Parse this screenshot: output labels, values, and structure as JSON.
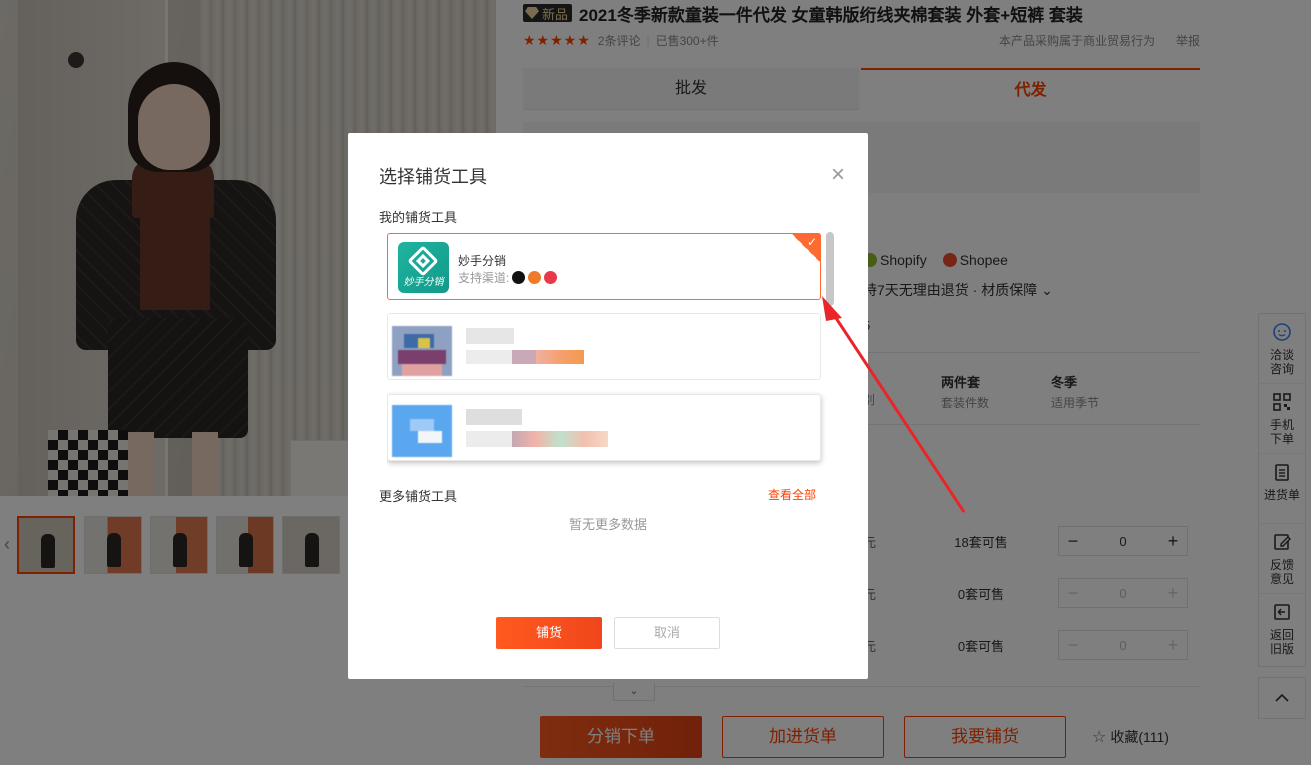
{
  "product": {
    "badge": "新品",
    "title": "2021冬季新款童装一件代发 女童韩版绗线夹棉套装 外套+短裤 套装",
    "rating_stars": "★★★★★",
    "reviews": "2条评论",
    "sold": "已售300+件",
    "notice": "本产品采购属于商业贸易行为",
    "report": "举报"
  },
  "tabs": {
    "wholesale": "批发",
    "dropship": "代发"
  },
  "channels": {
    "shopify": "Shopify",
    "shopee": "Shopee"
  },
  "guarantee": "持7天无理由退货 · 材质保障 ⌄",
  "peek": {
    "five": "5",
    "bie": "别",
    "yuan": "元"
  },
  "attributes": [
    {
      "value": "两件套",
      "key": "套装件数"
    },
    {
      "value": "冬季",
      "key": "适用季节"
    }
  ],
  "sku_rows": [
    {
      "available": "18套可售",
      "quantity": "0",
      "disabled": false
    },
    {
      "available": "0套可售",
      "quantity": "0",
      "disabled": true
    },
    {
      "available": "0套可售",
      "quantity": "0",
      "disabled": true
    }
  ],
  "stepper": {
    "minus": "−",
    "plus": "+"
  },
  "actions": {
    "order": "分销下单",
    "add_cart": "加进货单",
    "distribute": "我要铺货",
    "favorite": "收藏(111)"
  },
  "sidebar": [
    {
      "label": "洽谈咨询",
      "icon": "chat-icon"
    },
    {
      "label": "手机下单",
      "icon": "qrcode-icon"
    },
    {
      "label": "进货单",
      "icon": "clipboard-icon"
    },
    {
      "label": "反馈意见",
      "icon": "edit-icon"
    },
    {
      "label": "返回旧版",
      "icon": "back-icon"
    }
  ],
  "modal": {
    "title": "选择铺货工具",
    "my_tools_label": "我的铺货工具",
    "tools": [
      {
        "name": "妙手分销",
        "logo_text": "妙手分销",
        "channels_label": "支持渠道:",
        "selected": true
      }
    ],
    "more_tools_label": "更多铺货工具",
    "see_all": "查看全部",
    "no_more": "暂无更多数据",
    "confirm": "铺货",
    "cancel": "取消"
  },
  "colors": {
    "accent": "#ff4000",
    "app_green": "#1fb49f",
    "overlay": "rgba(0,0,0,0.5)"
  }
}
